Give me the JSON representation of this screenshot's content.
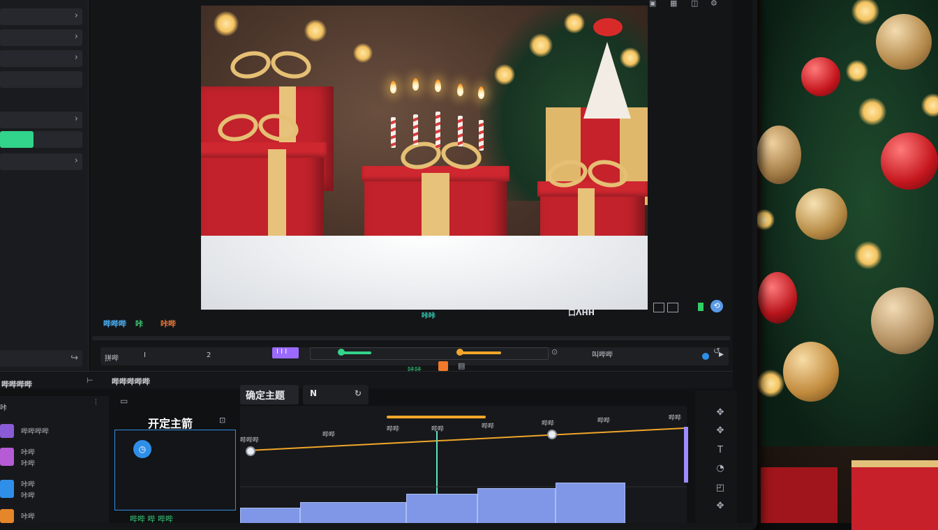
{
  "left_panel": {
    "row_labels": [
      "",
      "",
      "",
      "",
      "",
      "",
      "",
      ""
    ],
    "slider_value": 0.4
  },
  "preview": {
    "timecode_left": "哔哔哔",
    "marker_left": "咔",
    "rate_left": "咔哔",
    "transport_center": "咔咔",
    "right_status": "口ΛHH"
  },
  "controls": {
    "left_label": "拼哔",
    "btn_i": "I",
    "btn_2": "2",
    "clip_tag": "I I I",
    "right_label": "叫哔哔"
  },
  "timeline_header": {
    "left_title": "哔哔哔哔",
    "center_title": "哔哔哔哔哔"
  },
  "timeline_left_items": [
    {
      "color": "#8a5bd6",
      "label": "哔哔哔哔"
    },
    {
      "color": "#b55bd6",
      "label": "咔哔",
      "sub": "咔哔"
    },
    {
      "color": "#2f8fe8",
      "label": "咔哔",
      "sub": "咔哔"
    },
    {
      "color": "#e6862a",
      "label": "咔哔"
    }
  ],
  "timeline_mid": {
    "title": "开定主箭",
    "footer": "哔哔 哔 哔哔"
  },
  "timeline_main": {
    "tab_active": "确定主题",
    "tab_icon": "N",
    "markers": [
      "哔哔哔",
      "哔哔",
      "哔哔",
      "哔哔",
      "哔哔",
      "哔哔",
      "哔哔"
    ],
    "playhead_label": "哔哔",
    "top_label": "哔哔"
  },
  "status_right": {
    "label": "咔咔",
    "btn": "0"
  },
  "colors": {
    "accent_green": "#32d38a",
    "accent_orange": "#f0a62a",
    "accent_purple": "#9b6bff",
    "track_blue": "#7f97e6",
    "playhead": "#64e0c0"
  }
}
